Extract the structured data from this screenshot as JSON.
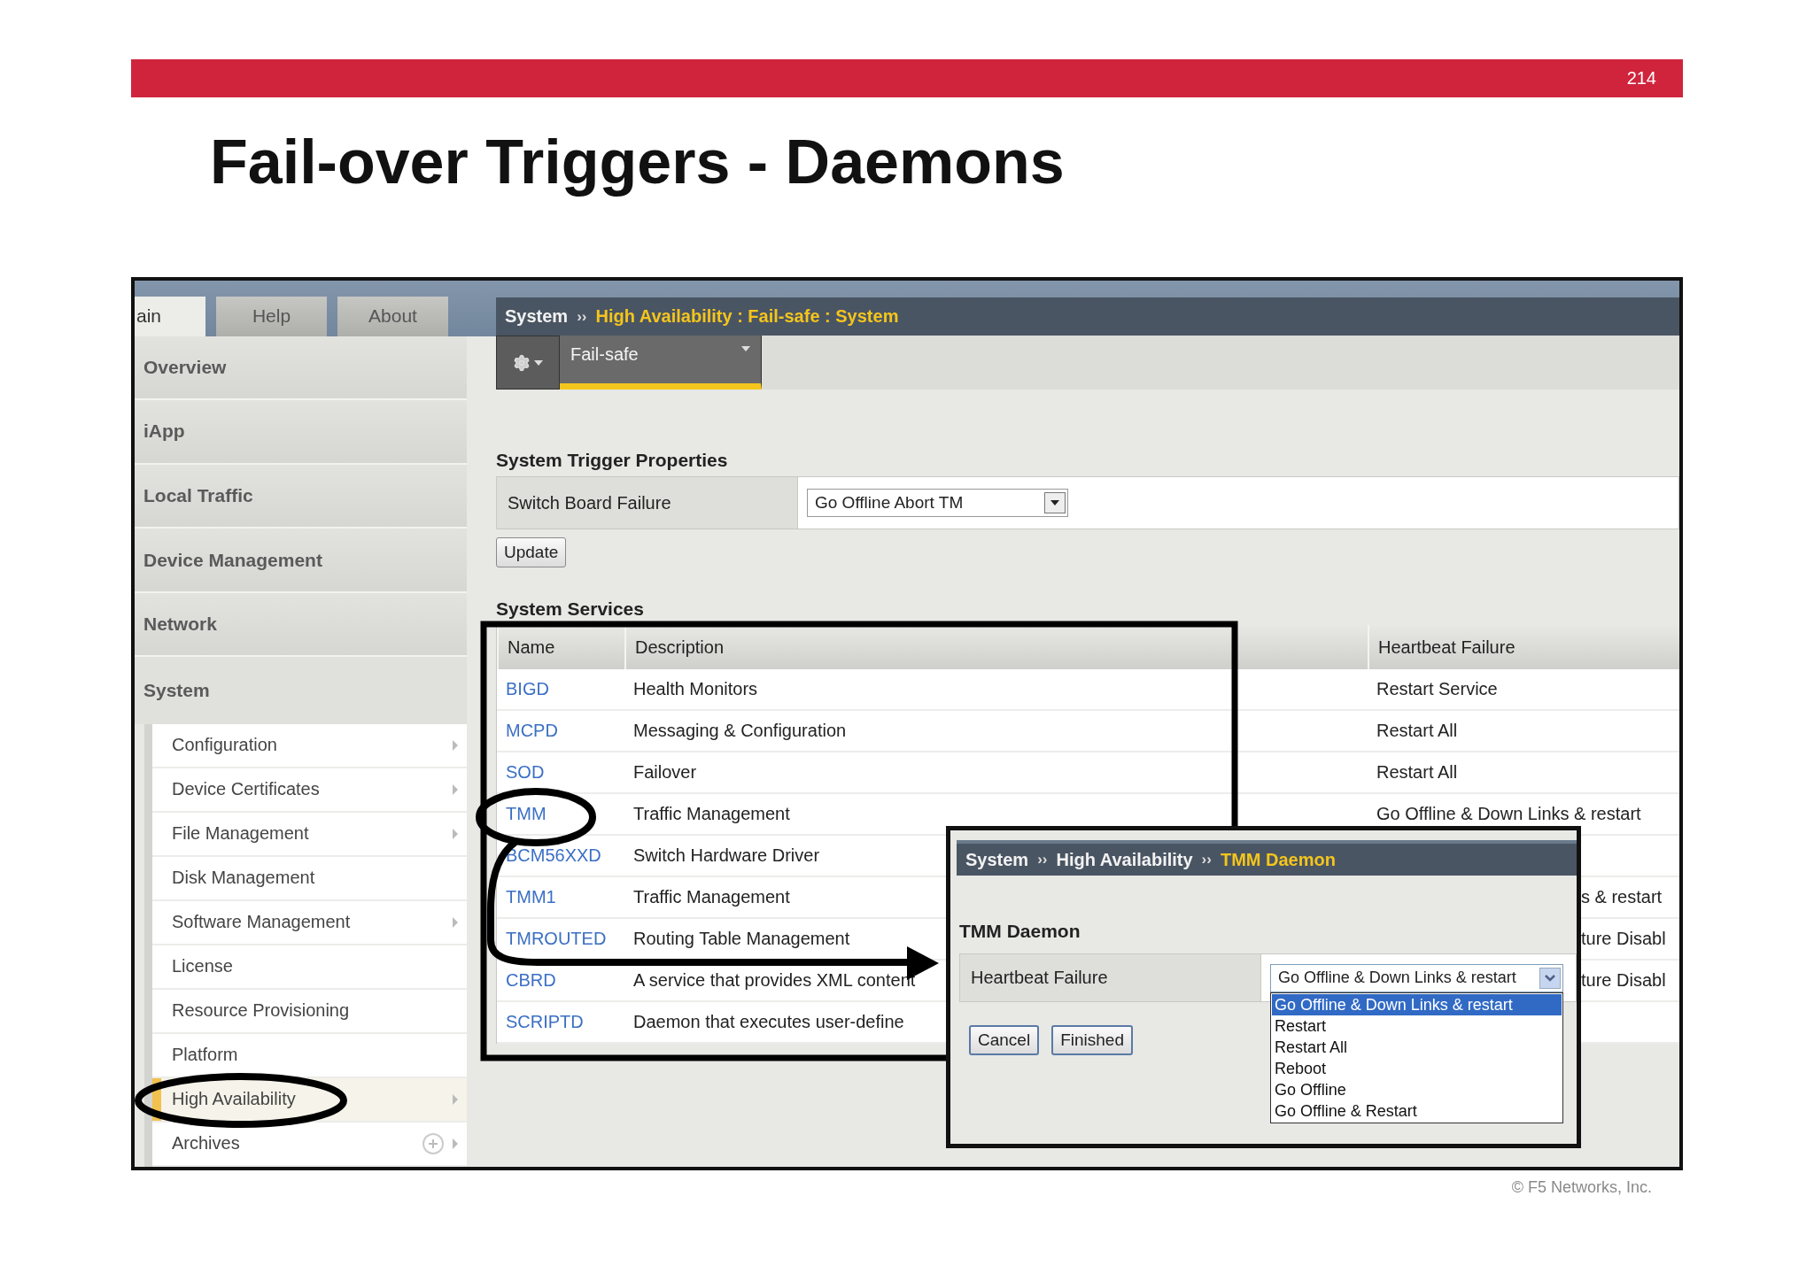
{
  "slide": {
    "page_number": "214",
    "title": "Fail-over Triggers - Daemons",
    "footer": "© F5 Networks, Inc."
  },
  "top_tabs": [
    {
      "label": "ain",
      "selected": true
    },
    {
      "label": "Help",
      "selected": false
    },
    {
      "label": "About",
      "selected": false
    }
  ],
  "sidebar": {
    "sections": [
      "Overview",
      "iApp",
      "Local Traffic",
      "Device Management",
      "Network",
      "System"
    ],
    "submenu": [
      {
        "label": "Configuration",
        "has_submenu": true,
        "has_add": false,
        "selected": false
      },
      {
        "label": "Device Certificates",
        "has_submenu": true,
        "has_add": false,
        "selected": false
      },
      {
        "label": "File Management",
        "has_submenu": true,
        "has_add": false,
        "selected": false
      },
      {
        "label": "Disk Management",
        "has_submenu": false,
        "has_add": false,
        "selected": false
      },
      {
        "label": "Software Management",
        "has_submenu": true,
        "has_add": false,
        "selected": false
      },
      {
        "label": "License",
        "has_submenu": false,
        "has_add": false,
        "selected": false
      },
      {
        "label": "Resource Provisioning",
        "has_submenu": false,
        "has_add": false,
        "selected": false
      },
      {
        "label": "Platform",
        "has_submenu": false,
        "has_add": false,
        "selected": false
      },
      {
        "label": "High Availability",
        "has_submenu": true,
        "has_add": false,
        "selected": true
      },
      {
        "label": "Archives",
        "has_submenu": true,
        "has_add": true,
        "selected": false
      }
    ]
  },
  "breadcrumb": {
    "separator": "››",
    "items": [
      {
        "text": "System",
        "current": false
      },
      {
        "text": "High Availability : Fail-safe : System",
        "current": true
      }
    ]
  },
  "toolbar": {
    "tab": "Fail-safe"
  },
  "trigger_properties": {
    "heading": "System Trigger Properties",
    "label": "Switch Board Failure",
    "value": "Go Offline Abort TM",
    "button": "Update"
  },
  "services": {
    "heading": "System Services",
    "columns": [
      "Name",
      "Description",
      "Heartbeat Failure"
    ],
    "rows": [
      {
        "name": "BIGD",
        "description": "Health Monitors",
        "heartbeat": "Restart Service",
        "cut": false
      },
      {
        "name": "MCPD",
        "description": "Messaging & Configuration",
        "heartbeat": "Restart All",
        "cut": false
      },
      {
        "name": "SOD",
        "description": "Failover",
        "heartbeat": "Restart All",
        "cut": false
      },
      {
        "name": "TMM",
        "description": "Traffic Management",
        "heartbeat": "Go Offline & Down Links & restart",
        "cut": false
      },
      {
        "name": "BCM56XXD",
        "description": "Switch Hardware Driver",
        "cut": false
      },
      {
        "name": "TMM1",
        "description": "Traffic Management",
        "heartbeat": "s & restart",
        "cut": true
      },
      {
        "name": "TMROUTED",
        "description": "Routing Table Management",
        "heartbeat": "ture Disabl",
        "cut": true
      },
      {
        "name": "CBRD",
        "description": "A service that provides XML content",
        "heartbeat": "ture Disabl",
        "cut": true
      },
      {
        "name": "SCRIPTD",
        "description": "Daemon that executes user-define",
        "cut": false
      }
    ]
  },
  "dialog": {
    "breadcrumb": {
      "separator": "››",
      "items": [
        {
          "text": "System",
          "current": false
        },
        {
          "text": "High Availability",
          "current": false
        },
        {
          "text": "TMM Daemon",
          "current": true
        }
      ]
    },
    "heading": "TMM Daemon",
    "label": "Heartbeat Failure",
    "value": "Go Offline & Down Links & restart",
    "options": [
      {
        "label": "Go Offline & Down Links & restart",
        "selected": true
      },
      {
        "label": "Restart",
        "selected": false
      },
      {
        "label": "Restart All",
        "selected": false
      },
      {
        "label": "Reboot",
        "selected": false
      },
      {
        "label": "Go Offline",
        "selected": false
      },
      {
        "label": "Go Offline & Restart",
        "selected": false
      }
    ],
    "buttons": [
      "Cancel",
      "Finished"
    ]
  }
}
